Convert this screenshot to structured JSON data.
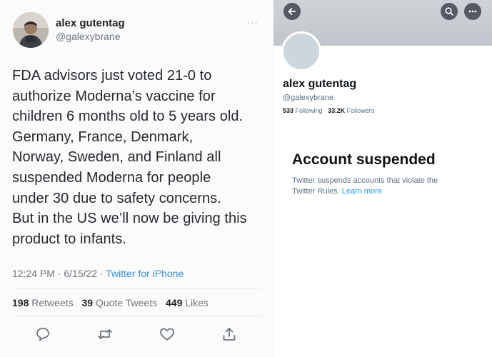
{
  "tweet": {
    "author_name": "alex gutentag",
    "handle": "@galexybrane",
    "more_label": "···",
    "body_lines": [
      "FDA advisors just voted 21-0 to",
      "authorize Moderna’s vaccine for",
      "children 6 months old to 5 years old.",
      "Germany, France, Denmark,",
      "Norway, Sweden, and Finland all",
      "suspended Moderna for people",
      "under 30 due to safety concerns.",
      "But in the US we’ll now be giving this",
      "product to infants."
    ],
    "time": "12:24 PM · 6/15/22 · ",
    "source": "Twitter for iPhone",
    "stats": {
      "retweets_count": "198",
      "retweets_label": "Retweets",
      "quotes_count": "39",
      "quotes_label": "Quote Tweets",
      "likes_count": "449",
      "likes_label": "Likes"
    },
    "actions": [
      "reply-icon",
      "retweet-icon",
      "like-icon",
      "share-icon"
    ],
    "icon_color": "#6f7780"
  },
  "profile": {
    "name": "alex gutentag",
    "handle": "@galexybrane",
    "following_count": "533",
    "following_label": "Following",
    "followers_count": "33.2K",
    "followers_label": "Followers",
    "suspended_title": "Account suspended",
    "suspended_text_1": "Twitter suspends accounts that violate the",
    "suspended_text_2": "Twitter Rules.",
    "learn_more": "Learn more",
    "accent": "#1d9bf0"
  }
}
